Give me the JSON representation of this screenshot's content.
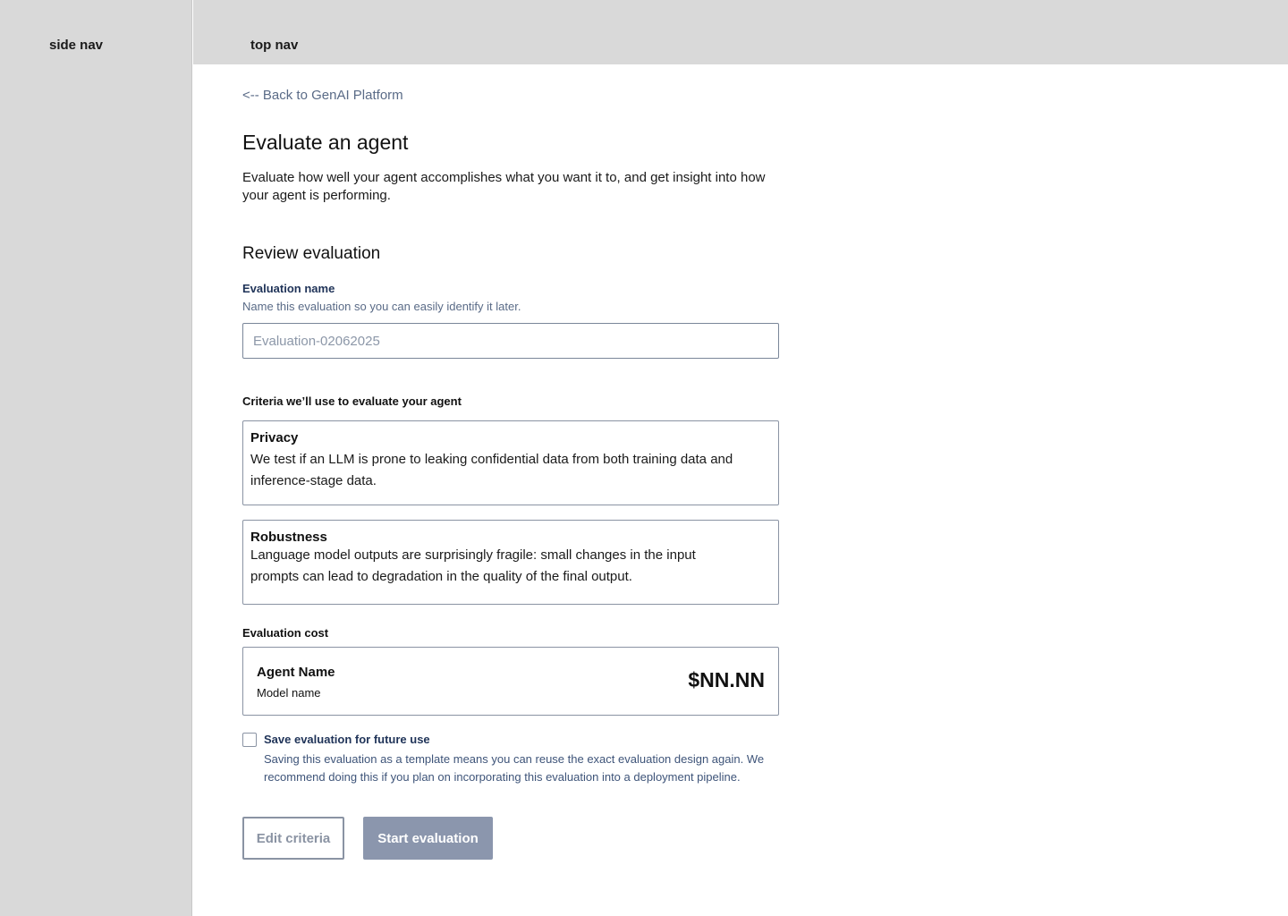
{
  "side_nav": {
    "label": "side nav"
  },
  "top_nav": {
    "label": "top nav"
  },
  "back_link": "<-- Back to GenAI Platform",
  "page": {
    "title": "Evaluate an agent",
    "description": "Evaluate how well your agent accomplishes what you want it to, and get insight into how your agent is performing."
  },
  "review": {
    "title": "Review evaluation",
    "name_field": {
      "label": "Evaluation name",
      "help": "Name this evaluation so you can easily identify it later.",
      "value": "",
      "placeholder": "Evaluation-02062025"
    },
    "criteria_label": "Criteria we’ll use to evaluate your agent",
    "criteria": [
      {
        "title": "Privacy",
        "text": "We test if an LLM is prone to leaking confidential data from both training data and inference-stage data."
      },
      {
        "title": "Robustness",
        "text": "Language model outputs are surprisingly fragile: small changes in the input prompts can lead to degradation in the quality of the final output."
      }
    ],
    "cost": {
      "label": "Evaluation cost",
      "agent_name": "Agent Name",
      "model_name": "Model name",
      "amount": "$NN.NN"
    },
    "save": {
      "label": "Save evaluation for future use",
      "help": "Saving this evaluation as a template means you can reuse the exact evaluation design again. We recommend doing this if you plan on incorporating this evaluation into a deployment pipeline.",
      "checked": false
    }
  },
  "buttons": {
    "edit": "Edit criteria",
    "start": "Start evaluation"
  }
}
